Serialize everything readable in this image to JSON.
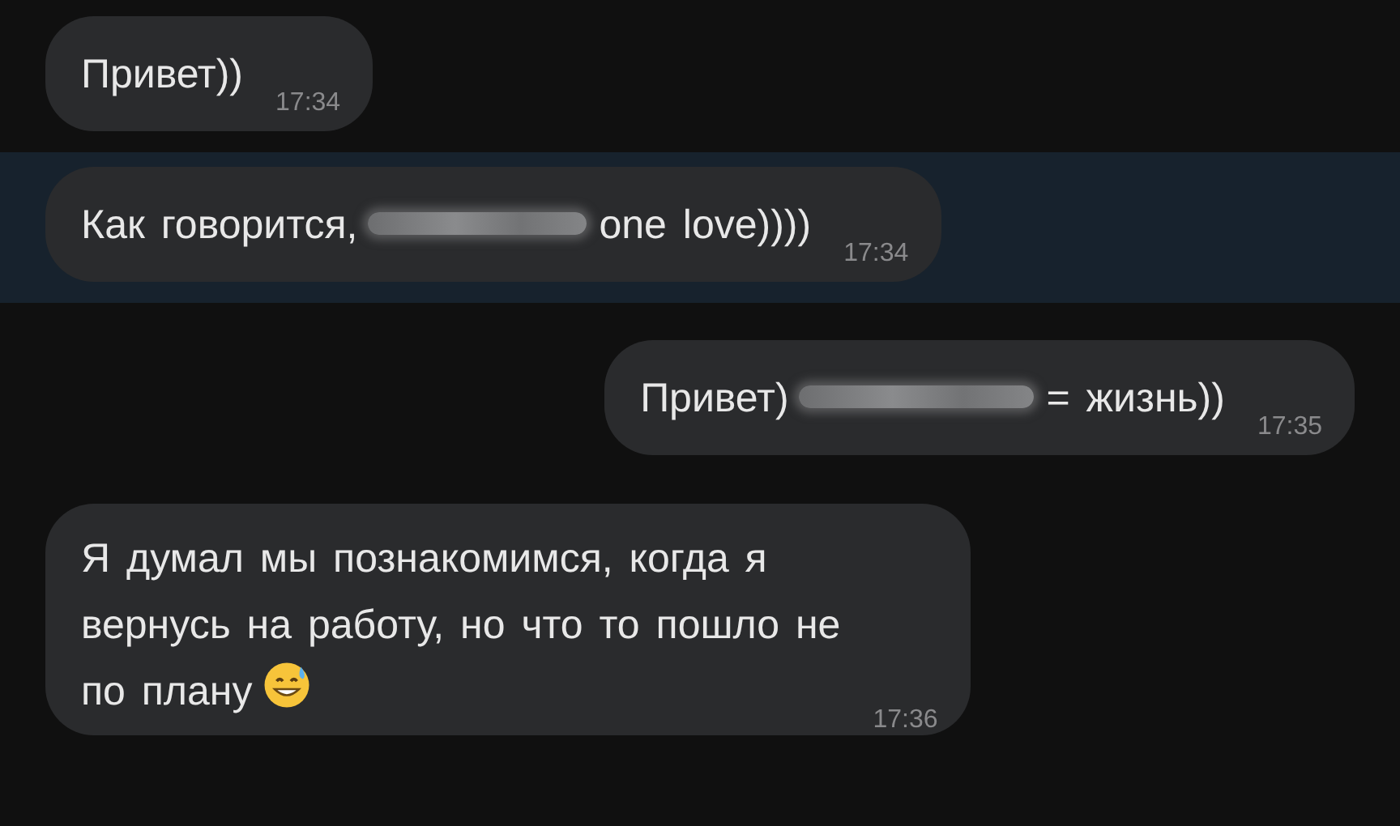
{
  "messages": [
    {
      "outgoing": false,
      "highlighted": false,
      "lines": [
        [
          {
            "kind": "text",
            "text": "Привет))"
          }
        ]
      ],
      "time": "17:34"
    },
    {
      "outgoing": false,
      "highlighted": true,
      "lines": [
        [
          {
            "kind": "text",
            "text": "Как говорится,"
          },
          {
            "kind": "redacted"
          },
          {
            "kind": "text",
            "text": "one love))))"
          }
        ]
      ],
      "time": "17:34"
    },
    {
      "outgoing": true,
      "highlighted": false,
      "lines": [
        [
          {
            "kind": "text",
            "text": "Привет)"
          },
          {
            "kind": "redacted"
          },
          {
            "kind": "text",
            "text": "= жизнь))"
          }
        ]
      ],
      "time": "17:35"
    },
    {
      "outgoing": false,
      "highlighted": false,
      "lines": [
        [
          {
            "kind": "text",
            "text": "Я думал мы познакомимся, когда я"
          }
        ],
        [
          {
            "kind": "text",
            "text": "вернусь на работу, но что то пошло не"
          }
        ],
        [
          {
            "kind": "text",
            "text": "по плану"
          },
          {
            "kind": "emoji"
          }
        ]
      ],
      "time": "17:36"
    }
  ]
}
